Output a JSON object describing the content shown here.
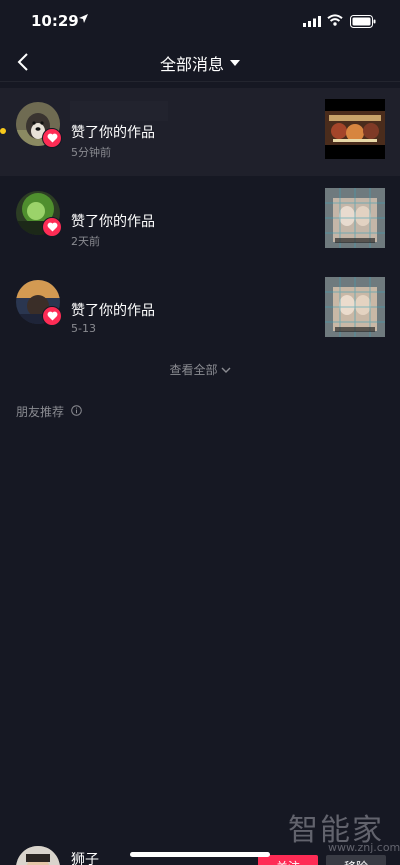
{
  "status_bar": {
    "time": "10:29"
  },
  "header": {
    "title": "全部消息"
  },
  "notifications": [
    {
      "action": "赞了你的作品",
      "time": "5分钟前",
      "unread": true
    },
    {
      "action": "赞了你的作品",
      "time": "2天前",
      "unread": false
    },
    {
      "action": "赞了你的作品",
      "time": "5-13",
      "unread": false
    }
  ],
  "view_all": {
    "label": "查看全部"
  },
  "friends_section": {
    "title": "朋友推荐",
    "recommendation": {
      "name": "狮子",
      "follow_label": "关注",
      "remove_label": "移除"
    }
  },
  "watermark": {
    "text": "智能家",
    "url": "www.znj.com"
  },
  "colors": {
    "background": "#161823",
    "accent": "#fe2c55",
    "unread_dot": "#f8c91c",
    "secondary_text": "#8a8b91"
  }
}
